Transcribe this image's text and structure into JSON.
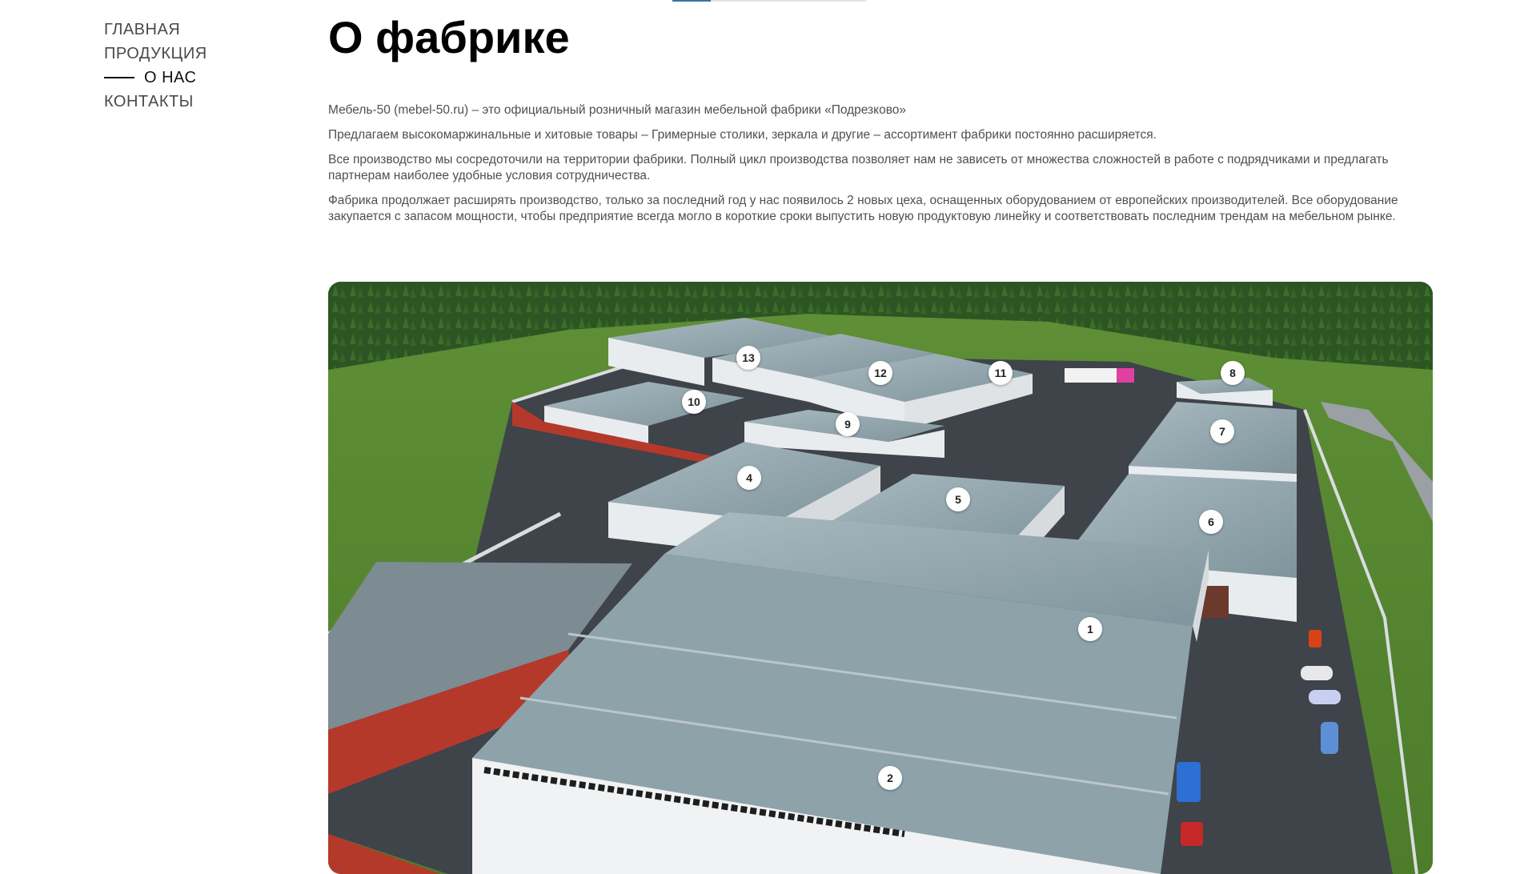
{
  "nav": {
    "items": [
      {
        "label": "ГЛАВНАЯ",
        "active": false
      },
      {
        "label": "ПРОДУКЦИЯ",
        "active": false
      },
      {
        "label": "О НАС",
        "active": true
      },
      {
        "label": "КОНТАКТЫ",
        "active": false
      }
    ]
  },
  "page": {
    "title": "О фабрике",
    "paragraphs": [
      "Мебель-50 (mebel-50.ru) – это официальный розничный магазин мебельной фабрики «Подрезково»",
      "Предлагаем высокомаржинальные и хитовые товары – Гримерные столики, зеркала и другие – ассортимент фабрики постоянно расширяется.",
      "Все производство мы сосредоточили на территории фабрики. Полный цикл производства позволяет нам не зависеть от множества сложностей в работе с подрядчиками и предлагать партнерам наиболее удобные условия сотрудничества.",
      "Фабрика продолжает расширять производство, только за последний год у нас появилось 2 новых цеха, оснащенных оборудованием от европейских производителей. Все оборудование закупается с запасом мощности, чтобы предприятие всегда могло в короткие сроки выпустить новую продуктовую линейку и соответствовать последним трендам на мебельном рынке."
    ]
  },
  "factory_map": {
    "markers": [
      "1",
      "2",
      "4",
      "5",
      "6",
      "7",
      "8",
      "9",
      "10",
      "11",
      "12",
      "13"
    ]
  },
  "colors": {
    "accent": "#3f6fa8",
    "grass": "#5a8a35",
    "forest": "#2f5a25",
    "asphalt": "#3f434a",
    "roof": "#8fa3ab",
    "wall": "#e9ecee",
    "brick": "#b5392b"
  }
}
